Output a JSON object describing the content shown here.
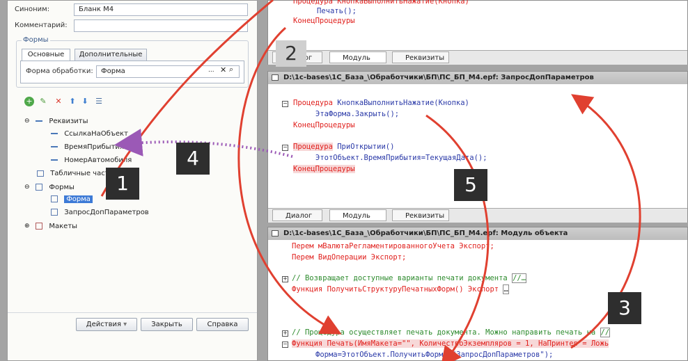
{
  "left": {
    "synonym_label": "Синоним:",
    "synonym_value": "Бланк М4",
    "comment_label": "Комментарий:",
    "comment_value": "",
    "forms_group": "Формы",
    "tabs": [
      "Основные",
      "Дополнительные"
    ],
    "form_label": "Форма обработки:",
    "form_value": "Форма",
    "tree": [
      {
        "label": "Реквизиты"
      },
      {
        "label": "СсылкаНаОбъект"
      },
      {
        "label": "ВремяПрибытия"
      },
      {
        "label": "НомерАвтомобиля"
      },
      {
        "label": "Табличные части"
      },
      {
        "label": "Формы"
      },
      {
        "label": "Форма"
      },
      {
        "label": "ЗапросДопПараметров"
      },
      {
        "label": "Макеты"
      }
    ],
    "buttons": {
      "actions": "Действия",
      "close": "Закрыть",
      "help": "Справка"
    }
  },
  "top_win": {
    "line1": "Процедура КнопкаВыполнитьНажатие(Кнопка)",
    "line2": "Печать();",
    "line3": "КонецПроцедуры",
    "tabs": [
      "Диалог",
      "Модуль",
      "Реквизиты"
    ]
  },
  "mid_win": {
    "title": "D:\\1c-bases\\1С_База_\\Обработчики\\БП\\ПС_БП_М4.epf: ЗапросДопПараметров",
    "l1_kw": "Процедура",
    "l1_id": "КнопкаВыполнитьНажатие(Кнопка)",
    "l2": "ЭтаФорма.Закрыть();",
    "l3": "КонецПроцедуры",
    "l4_kw": "Процедура",
    "l4_id": "ПриОткрытии()",
    "l5": "ЭтотОбъект.ВремяПрибытия=ТекущаяДата();",
    "l6": "КонецПроцедуры",
    "tabs": [
      "Диалог",
      "Модуль",
      "Реквизиты"
    ]
  },
  "bot_win": {
    "title": "D:\\1c-bases\\1С_База_\\Обработчики\\БП\\ПС_БП_М4.epf: Модуль объекта",
    "l1": "Перем мВалютаРегламентированногоУчета Экспорт;",
    "l2": "Перем ВидОперации Экспорт;",
    "l3": "// Возвращает доступные варианты печати документа",
    "l3_tail": "//…",
    "l4": "Функция ПолучитьСтруктуруПечатныхФорм() Экспорт",
    "l4_tail": "…",
    "l5": "// Процедура осуществляет печать документа. Можно направить печать на",
    "l5_tail": "//",
    "l6": "Функция Печать(ИмяМакета=\"\", КоличествоЭкземпляров = 1, НаПринтер = Ложь",
    "l7": "Форма=ЭтотОбъект.ПолучитьФорму(\"ЗапросДопПараметров\");"
  },
  "badges": [
    "1",
    "2",
    "3",
    "4",
    "5"
  ],
  "colors": {
    "arrow": "#e04030",
    "dotted": "#9b59b6",
    "badge": "#2e2e2e"
  }
}
